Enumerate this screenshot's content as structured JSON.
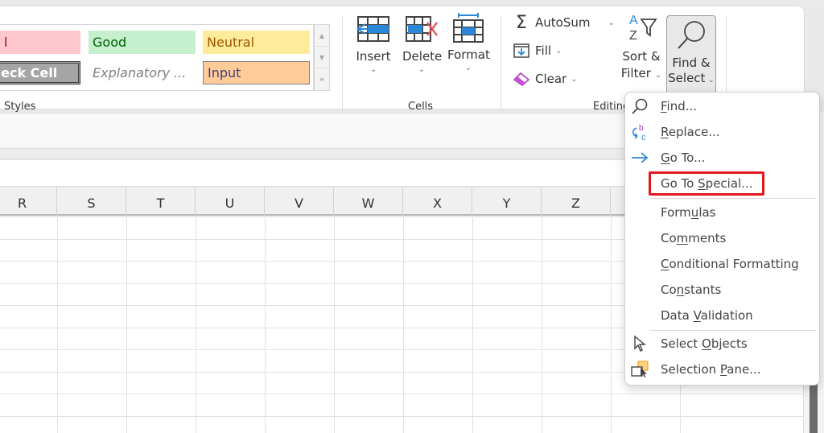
{
  "ribbon": {
    "styles_group": {
      "label": "Styles",
      "cells": [
        {
          "name": "bad",
          "label": "l"
        },
        {
          "name": "good",
          "label": "Good"
        },
        {
          "name": "neutral",
          "label": "Neutral"
        },
        {
          "name": "check-cell",
          "label": "Check Cell"
        },
        {
          "name": "explanatory",
          "label": "Explanatory ..."
        },
        {
          "name": "input",
          "label": "Input"
        }
      ]
    },
    "cells_group": {
      "label": "Cells",
      "buttons": [
        {
          "label": "Insert"
        },
        {
          "label": "Delete"
        },
        {
          "label": "Format"
        }
      ]
    },
    "editing_group": {
      "label": "Editing",
      "autosum": "AutoSum",
      "fill": "Fill",
      "clear": "Clear",
      "sort_filter_line1": "Sort &",
      "sort_filter_line2": "Filter",
      "find_select_line1": "Find &",
      "find_select_line2": "Select"
    }
  },
  "grid": {
    "columns": [
      "R",
      "S",
      "T",
      "U",
      "V",
      "W",
      "X",
      "Y",
      "Z",
      ""
    ]
  },
  "find_select_menu": {
    "items": [
      {
        "pre": "",
        "u": "F",
        "post": "ind...",
        "icon": "search-icon"
      },
      {
        "pre": "",
        "u": "R",
        "post": "eplace...",
        "icon": "replace-icon"
      },
      {
        "pre": "",
        "u": "G",
        "post": "o To...",
        "icon": "arrow-right-icon"
      },
      {
        "pre": "Go To ",
        "u": "S",
        "post": "pecial...",
        "icon": ""
      },
      {
        "pre": "Form",
        "u": "u",
        "post": "las",
        "icon": ""
      },
      {
        "pre": "Co",
        "u": "m",
        "post": "ments",
        "icon": ""
      },
      {
        "pre": "",
        "u": "C",
        "post": "onditional Formatting",
        "icon": ""
      },
      {
        "pre": "Co",
        "u": "n",
        "post": "stants",
        "icon": ""
      },
      {
        "pre": "Data ",
        "u": "V",
        "post": "alidation",
        "icon": ""
      },
      {
        "pre": "Select ",
        "u": "O",
        "post": "bjects",
        "icon": "cursor-icon"
      },
      {
        "pre": "Selection ",
        "u": "P",
        "post": "ane...",
        "icon": "selection-pane-icon"
      }
    ],
    "highlighted_item": "Go To Special..."
  },
  "colors": {
    "highlight": "#e3171f",
    "accent_blue": "#2b88d8",
    "scroll_thumb": "#6b6b6b"
  }
}
